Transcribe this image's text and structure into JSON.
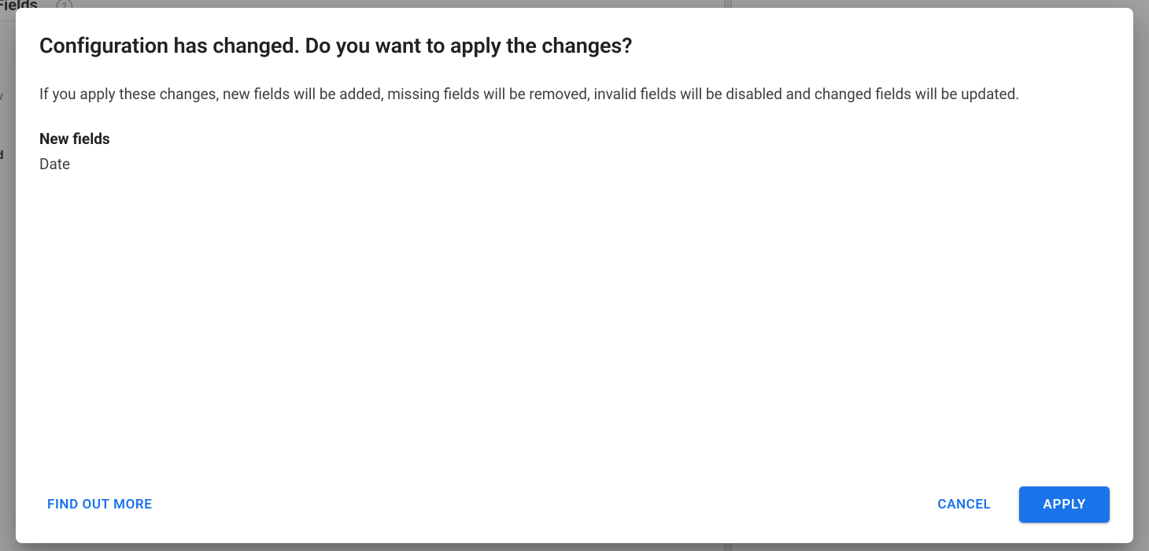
{
  "background": {
    "fields_label": "Fields",
    "help_glyph": "?",
    "text_fragment_1": "tiv",
    "text_fragment_2": "ld"
  },
  "modal": {
    "title": "Configuration has changed. Do you want to apply the changes?",
    "description": "If you apply these changes, new fields will be added, missing fields will be removed, invalid fields will be disabled and changed fields will be updated.",
    "sections": {
      "new_fields": {
        "header": "New fields",
        "items": [
          "Date"
        ]
      }
    },
    "actions": {
      "find_out_more": "FIND OUT MORE",
      "cancel": "CANCEL",
      "apply": "APPLY"
    }
  }
}
